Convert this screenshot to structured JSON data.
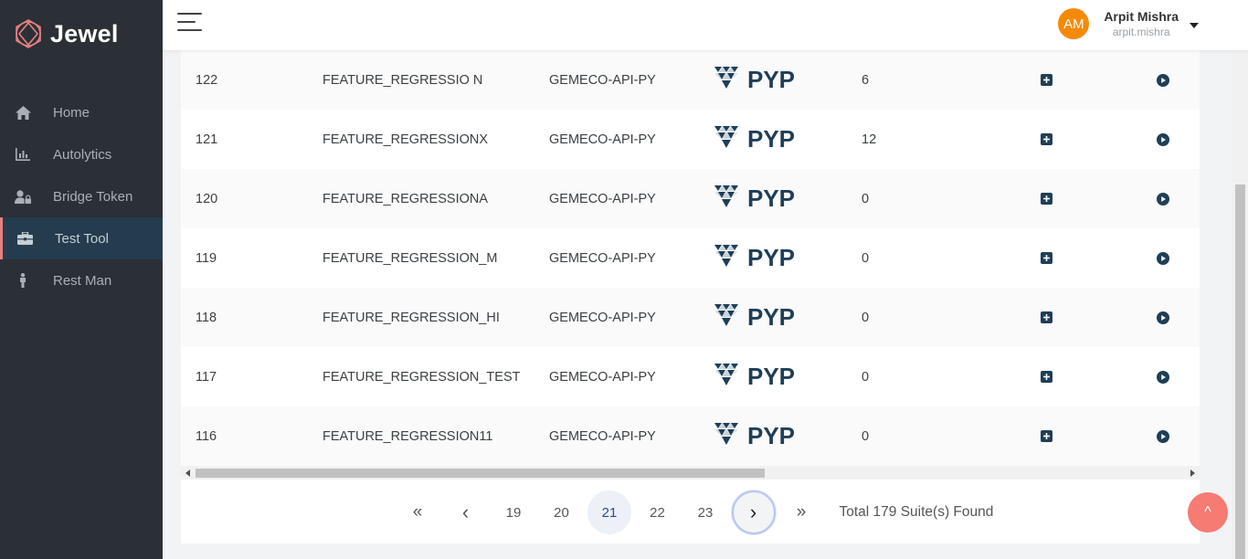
{
  "brand": {
    "name": "Jewel"
  },
  "sidebar": {
    "items": [
      {
        "label": "Home",
        "icon": "home-icon"
      },
      {
        "label": "Autolytics",
        "icon": "bar-chart-icon"
      },
      {
        "label": "Bridge Token",
        "icon": "user-lock-icon"
      },
      {
        "label": "Test Tool",
        "icon": "toolbox-icon",
        "active": true
      },
      {
        "label": "Rest Man",
        "icon": "person-icon"
      }
    ]
  },
  "header": {
    "user": {
      "initials": "AM",
      "name": "Arpit Mishra",
      "handle": "arpit.mishra"
    }
  },
  "table": {
    "rows": [
      {
        "id": "122",
        "name": "FEATURE_REGRESSIO N",
        "project": "GEMECO-API-PY",
        "framework": "PYP",
        "count": "6"
      },
      {
        "id": "121",
        "name": "FEATURE_REGRESSIONX",
        "project": "GEMECO-API-PY",
        "framework": "PYP",
        "count": "12"
      },
      {
        "id": "120",
        "name": "FEATURE_REGRESSIONA",
        "project": "GEMECO-API-PY",
        "framework": "PYP",
        "count": "0"
      },
      {
        "id": "119",
        "name": "FEATURE_REGRESSION_M",
        "project": "GEMECO-API-PY",
        "framework": "PYP",
        "count": "0"
      },
      {
        "id": "118",
        "name": "FEATURE_REGRESSION_HI",
        "project": "GEMECO-API-PY",
        "framework": "PYP",
        "count": "0"
      },
      {
        "id": "117",
        "name": "FEATURE_REGRESSION_TEST",
        "project": "GEMECO-API-PY",
        "framework": "PYP",
        "count": "0"
      },
      {
        "id": "116",
        "name": "FEATURE_REGRESSION11",
        "project": "GEMECO-API-PY",
        "framework": "PYP",
        "count": "0"
      }
    ]
  },
  "pagination": {
    "first": "«",
    "prev": "‹",
    "pages": [
      "19",
      "20",
      "21",
      "22",
      "23"
    ],
    "current": "21",
    "next": "›",
    "last": "»",
    "total_text": "Total 179 Suite(s) Found"
  },
  "back_to_top": "^",
  "colors": {
    "sidebar_bg": "#2a3036",
    "active_accent": "#e98080",
    "avatar": "#f58a07",
    "action_navy": "#1f3e57",
    "back_to_top": "#f57b73"
  }
}
